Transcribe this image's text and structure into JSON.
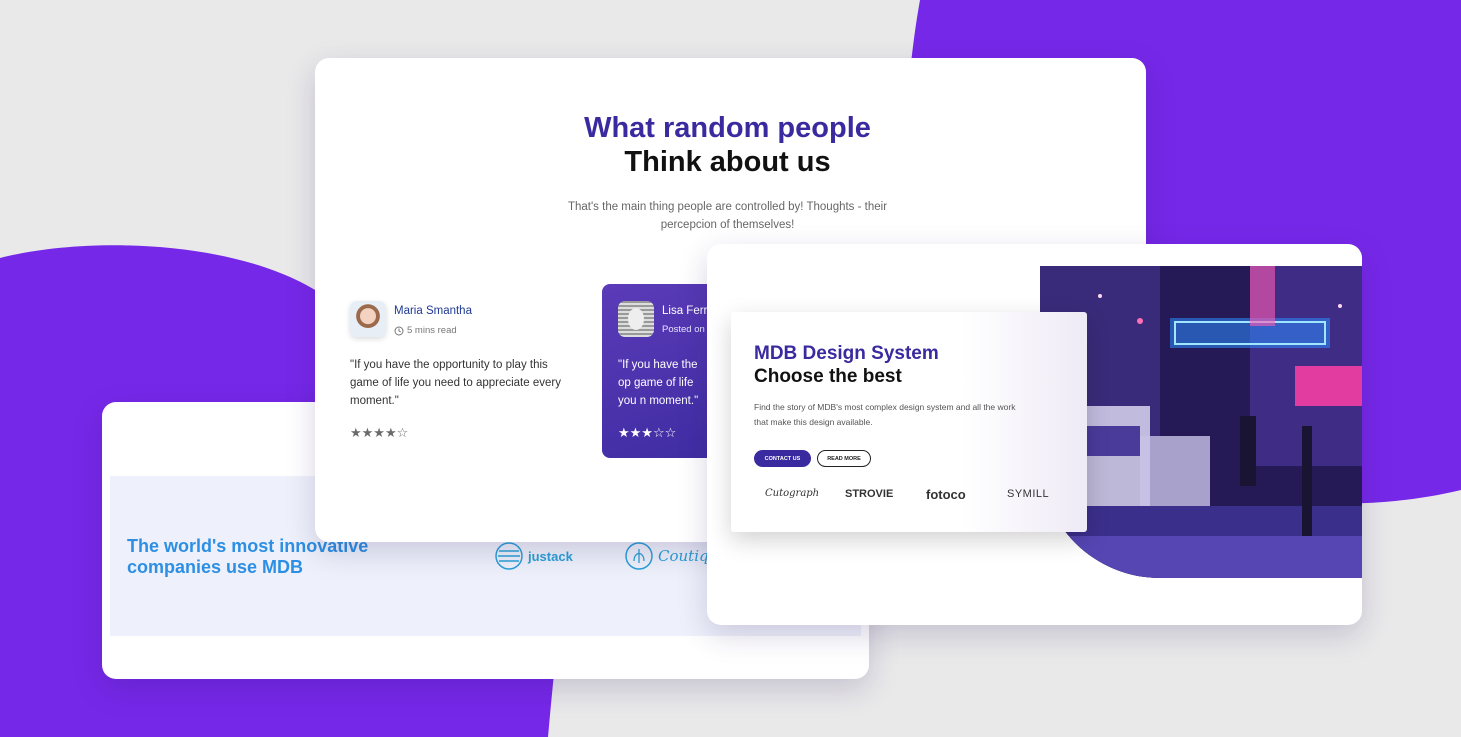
{
  "colors": {
    "purple": "#7628e8",
    "deep_indigo": "#3a2a9f",
    "brand_blue": "#2d8fe3",
    "background": "#e9e9ea"
  },
  "brands_card": {
    "heading": "The world's most innovative companies use MDB",
    "logos": [
      {
        "icon": "justack-logo-icon",
        "label": "justack"
      },
      {
        "icon": "coutique-logo-icon",
        "label": "Coutiqu"
      }
    ]
  },
  "testimonials_card": {
    "heading_line1": "What random people",
    "heading_line2": "Think about us",
    "subtitle": "That's the main thing people are controlled by! Thoughts - their percepcion of themselves!",
    "reviews": [
      {
        "name": "Maria Smantha",
        "meta": "5 mins read",
        "meta_icon": "clock-icon",
        "quote": "\"If you have the opportunity to play this game of life you need to appreciate every moment.\"",
        "stars": "★★★★☆",
        "rating": 4
      },
      {
        "name": "Lisa Ferr",
        "meta": "Posted on",
        "quote": "\"If you have the op game of life you n moment.\"",
        "stars": "★★★☆☆",
        "rating": 3
      }
    ]
  },
  "hero_card": {
    "title_line1": "MDB Design System",
    "title_line2": "Choose the best",
    "description": "Find the story of MDB's most complex design system and all the work that make this design available.",
    "buttons": {
      "contact": "CONTACT US",
      "read_more": "READ MORE"
    },
    "brands": [
      "Cutograph",
      "STROVIE",
      "fotoco",
      "SYMILL"
    ],
    "image_alt": "neon-city-street-night-image"
  }
}
